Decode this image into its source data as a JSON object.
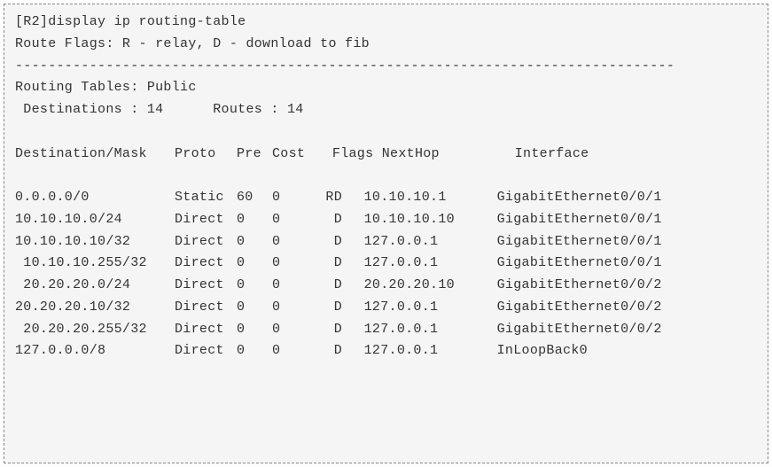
{
  "cmd_line": "[R2]display ip routing-table",
  "flags_legend": "Route Flags: R - relay, D - download to fib",
  "separator": "--------------------------------------------------------------------------------",
  "tables_header": "Routing Tables: Public",
  "dest_label": " Destinations : ",
  "dest_count": "14",
  "routes_label": "      Routes : ",
  "routes_count": "14",
  "headers": {
    "dest": "Destination/Mask",
    "proto": "Proto",
    "pre": "Pre",
    "cost": "Cost",
    "flags": "Flags",
    "nexthop": "NextHop",
    "iface": "Interface"
  },
  "rows": [
    {
      "dest": "0.0.0.0/0",
      "proto": "Static",
      "pre": "60",
      "cost": "0",
      "flags": "RD",
      "nh": "10.10.10.1",
      "if": "GigabitEthernet0/0/1",
      "pad": ""
    },
    {
      "dest": "10.10.10.0/24",
      "proto": "Direct",
      "pre": "0",
      "cost": "0",
      "flags": "D",
      "nh": "10.10.10.10",
      "if": "GigabitEthernet0/0/1",
      "pad": ""
    },
    {
      "dest": "10.10.10.10/32",
      "proto": "Direct",
      "pre": "0",
      "cost": "0",
      "flags": "D",
      "nh": "127.0.0.1",
      "if": "GigabitEthernet0/0/1",
      "pad": ""
    },
    {
      "dest": "10.10.10.255/32",
      "proto": "Direct",
      "pre": "0",
      "cost": "0",
      "flags": "D",
      "nh": "127.0.0.1",
      "if": "GigabitEthernet0/0/1",
      "pad": " "
    },
    {
      "dest": "20.20.20.0/24",
      "proto": "Direct",
      "pre": "0",
      "cost": "0",
      "flags": "D",
      "nh": "20.20.20.10",
      "if": "GigabitEthernet0/0/2",
      "pad": " "
    },
    {
      "dest": "20.20.20.10/32",
      "proto": "Direct",
      "pre": "0",
      "cost": "0",
      "flags": "D",
      "nh": "127.0.0.1",
      "if": "GigabitEthernet0/0/2",
      "pad": ""
    },
    {
      "dest": "20.20.20.255/32",
      "proto": "Direct",
      "pre": "0",
      "cost": "0",
      "flags": "D",
      "nh": "127.0.0.1",
      "if": "GigabitEthernet0/0/2",
      "pad": " "
    },
    {
      "dest": "127.0.0.0/8",
      "proto": "Direct",
      "pre": "0",
      "cost": "0",
      "flags": "D",
      "nh": "127.0.0.1",
      "if": "InLoopBack0",
      "pad": ""
    }
  ]
}
